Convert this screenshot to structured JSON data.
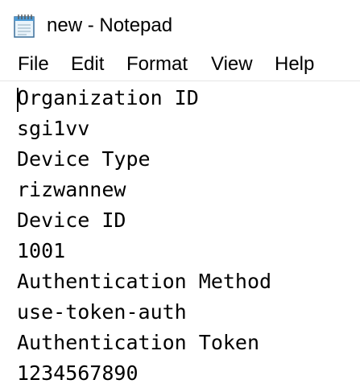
{
  "window": {
    "title": "new - Notepad",
    "icon": "notepad-icon"
  },
  "menu": {
    "items": [
      {
        "label": "File"
      },
      {
        "label": "Edit"
      },
      {
        "label": "Format"
      },
      {
        "label": "View"
      },
      {
        "label": "Help"
      }
    ]
  },
  "editor": {
    "lines": [
      "Organization ID",
      "sgi1vv",
      "Device Type",
      "rizwannew",
      "Device ID",
      "1001",
      "Authentication Method",
      "use-token-auth",
      "Authentication Token",
      "1234567890"
    ]
  }
}
